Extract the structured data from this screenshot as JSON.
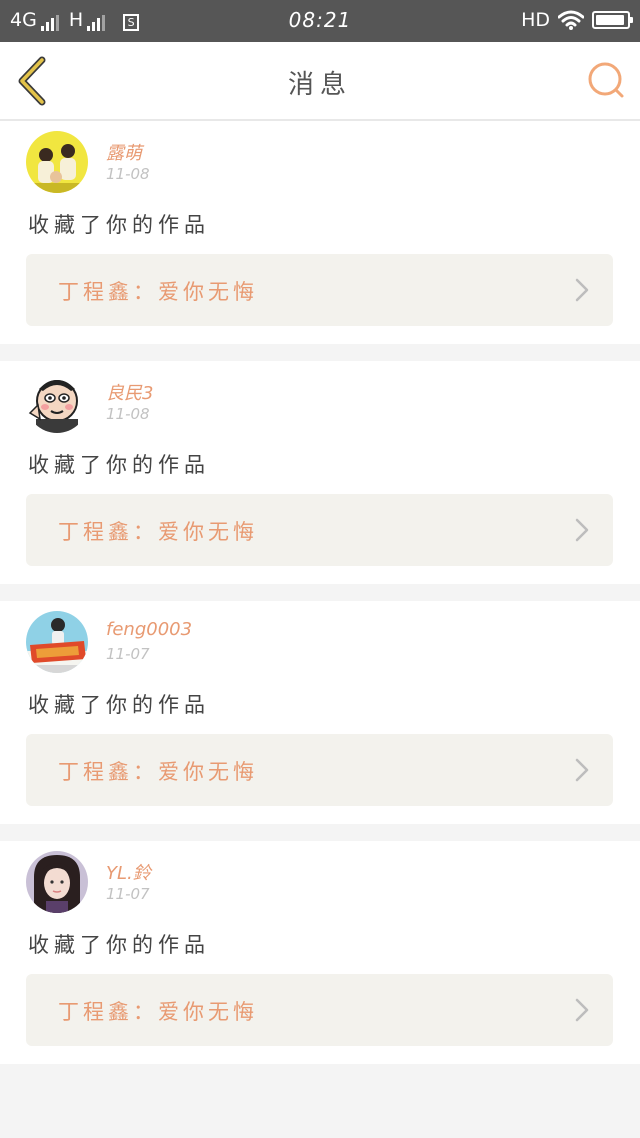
{
  "status_bar": {
    "network_1": "4G",
    "network_2": "H",
    "sim_label": "S",
    "time": "08:21",
    "hd_label": "HD"
  },
  "nav": {
    "title": "消息"
  },
  "colors": {
    "accent": "#e89a72",
    "back_arrow": "#c8a520",
    "work_bg": "#f3f2ed"
  },
  "notifications": [
    {
      "user": "露萌",
      "date": "11-08",
      "action": "收藏了你的作品",
      "work": "丁程鑫：爱你无悔",
      "avatar_icon": "yellow-group-avatar"
    },
    {
      "user": "良民3",
      "date": "11-08",
      "action": "收藏了你的作品",
      "work": "丁程鑫：爱你无悔",
      "avatar_icon": "cartoon-face-avatar"
    },
    {
      "user": "feng0003",
      "date": "11-07",
      "action": "收藏了你的作品",
      "work": "丁程鑫：爱你无悔",
      "avatar_icon": "banner-photo-avatar"
    },
    {
      "user": "YL.鈴",
      "date": "11-07",
      "action": "收藏了你的作品",
      "work": "丁程鑫：爱你无悔",
      "avatar_icon": "girl-portrait-avatar"
    }
  ]
}
